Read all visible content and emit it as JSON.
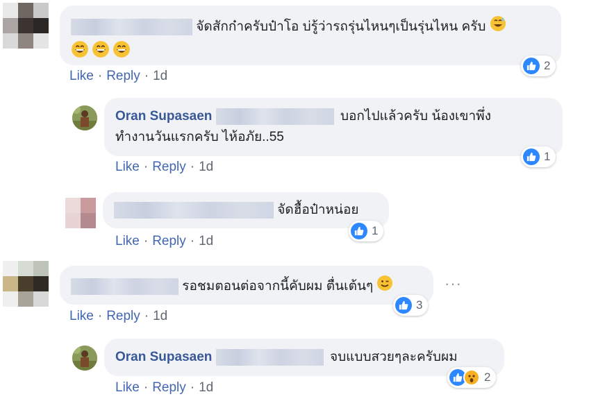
{
  "comments": [
    {
      "text_line1": "จัดสักก๋าครับป๋าโอ บ่รู้ว่ารถรุ่นไหนๆเป็นรุ่นไหน ครับ",
      "like": "Like",
      "reply": "Reply",
      "time": "1d",
      "reaction_count": "2"
    },
    {
      "author": "Oran Supasaen",
      "text_line1": "บอกไปแล้วครับ น้องเขาพึ่ง",
      "text_line2": "ทำงานวันแรกครับ ไห้อภัย..55",
      "like": "Like",
      "reply": "Reply",
      "time": "1d",
      "reaction_count": "1"
    },
    {
      "text_line1": "จัดฮื้อป๋าหน่อย",
      "like": "Like",
      "reply": "Reply",
      "time": "1d",
      "reaction_count": "1"
    },
    {
      "text_line1": "รอชมตอนต่อจากนี้คับผม ตื่นเต้นๆ",
      "like": "Like",
      "reply": "Reply",
      "time": "1d",
      "reaction_count": "3",
      "more": "···"
    },
    {
      "author": "Oran Supasaen",
      "text_line1": "จบแบบสวยๆละครับผม",
      "like": "Like",
      "reply": "Reply",
      "time": "1d",
      "reaction_count": "2"
    }
  ],
  "colors": {
    "bubble": "#f0f2f5",
    "author": "#385898",
    "action": "#4267b2",
    "like_blue": "#2d88ff",
    "wow_yellow": "#f7b125"
  },
  "icons": [
    "like-icon",
    "wow-icon",
    "grinning-emoji",
    "sweat-smile-emoji",
    "wink-emoji",
    "more-dots-icon"
  ]
}
